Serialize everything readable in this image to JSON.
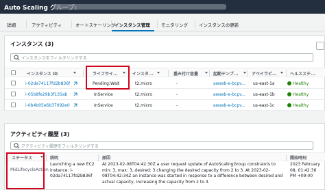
{
  "header": {
    "title": "Auto Scaling グループ:"
  },
  "tabs": [
    {
      "label": "詳細"
    },
    {
      "label": "アクティビティ"
    },
    {
      "label": "オートスケーリング"
    },
    {
      "label": "インスタンス管理"
    },
    {
      "label": "モニタリング"
    },
    {
      "label": "インスタンスの更新"
    }
  ],
  "instances": {
    "title": "インスタンス (3)",
    "search_placeholder": "インスタンスをフィルタリングする",
    "columns": [
      "インスタンス ID",
      "ライフサイ...",
      "インスタ...",
      "重み付け容量",
      "起動テンプ...",
      "アベイラビ...",
      "ヘルスステ..."
    ],
    "rows": [
      {
        "id": "i-02da74117fd2b836f",
        "lifecycle": "Pending:Wait",
        "type": "t2.micro",
        "weight": "-",
        "template": "awseb-e-bcpv...",
        "az": "us-east-1a",
        "health": "Healthy"
      },
      {
        "id": "i-05b8fe29b3f135ab",
        "lifecycle": "InService",
        "type": "t2.micro",
        "weight": "-",
        "template": "awseb-e-bcpv...",
        "az": "us-east-1b",
        "health": "Healthy"
      },
      {
        "id": "i-0b4b05e6b37092e0",
        "lifecycle": "InService",
        "type": "t2.micro",
        "weight": "-",
        "template": "awseb-e-bcpv...",
        "az": "us-east-1c",
        "health": "Healthy"
      }
    ]
  },
  "activity": {
    "title": "アクティビティ履歴 (3)",
    "search_placeholder": "アクティビティ履歴をフィルタリングする",
    "columns": [
      "ステータス",
      "説明",
      "原因",
      "開始時刻"
    ],
    "row": {
      "status": "MidLifecycleAction",
      "description": "Launching a new EC2 instance: i-02da74117fd2b836f",
      "cause": "At 2023-02-08T04:42:30Z a user request update of AutoScalingGroup constraints to min: 3, max: 3, desired: 3 changing the desired capacity from 2 to 3. At 2023-02-08T04:42:34Z an instance was started in response to a difference between desired and actual capacity, increasing the capacity from 2 to 3.",
      "start_time": "2023 February 08, 01:42:36 PM +09:00"
    }
  },
  "colors": {
    "accent": "#0073bb",
    "highlight": "#d0021b",
    "healthy": "#1d8102"
  }
}
